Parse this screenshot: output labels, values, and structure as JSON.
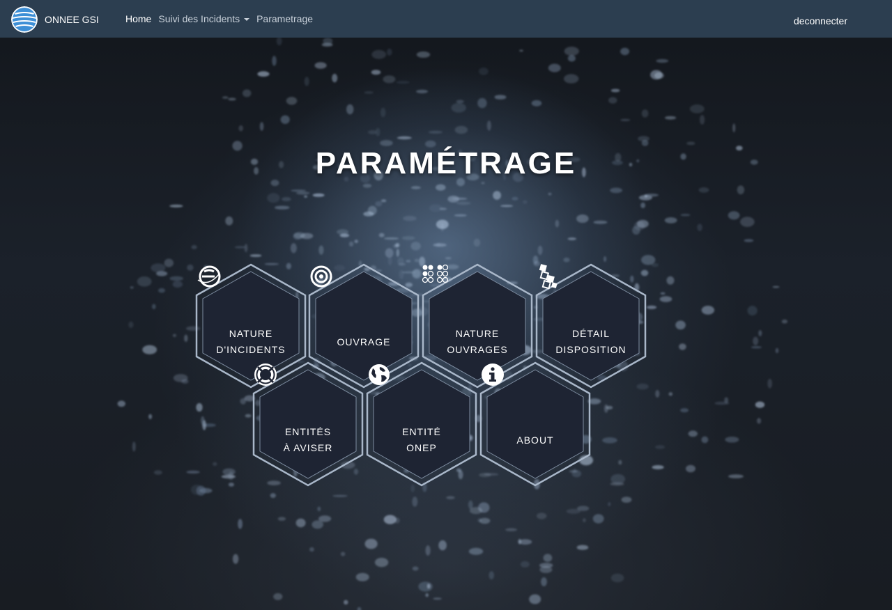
{
  "navbar": {
    "brand": "ONNEE GSI",
    "links": [
      {
        "label": "Home",
        "active": true
      },
      {
        "label": "Suivi des Incidents",
        "dropdown": true
      },
      {
        "label": "Parametrage"
      }
    ],
    "logout": "deconnecter"
  },
  "page": {
    "title": "PARAMÉTRAGE"
  },
  "tiles": [
    {
      "label": "NATURE\nD'INCIDENTS",
      "icon": "globe-orbit-icon"
    },
    {
      "label": "OUVRAGE",
      "icon": "target-icon"
    },
    {
      "label": "NATURE\nOUVRAGES",
      "icon": "dots-grid-icon"
    },
    {
      "label": "DÉTAIL\nDISPOSITION",
      "icon": "cubes-icon"
    },
    {
      "label": "ENTITÉS\nÀ AVISER",
      "icon": "lifebuoy-icon"
    },
    {
      "label": "ENTITÉ\nONEP",
      "icon": "earth-icon"
    },
    {
      "label": "ABOUT",
      "icon": "info-icon"
    }
  ],
  "colors": {
    "navbar": "#2c3e50",
    "hex_fill": "#1e2433",
    "hex_border": "#a9b7c9"
  }
}
